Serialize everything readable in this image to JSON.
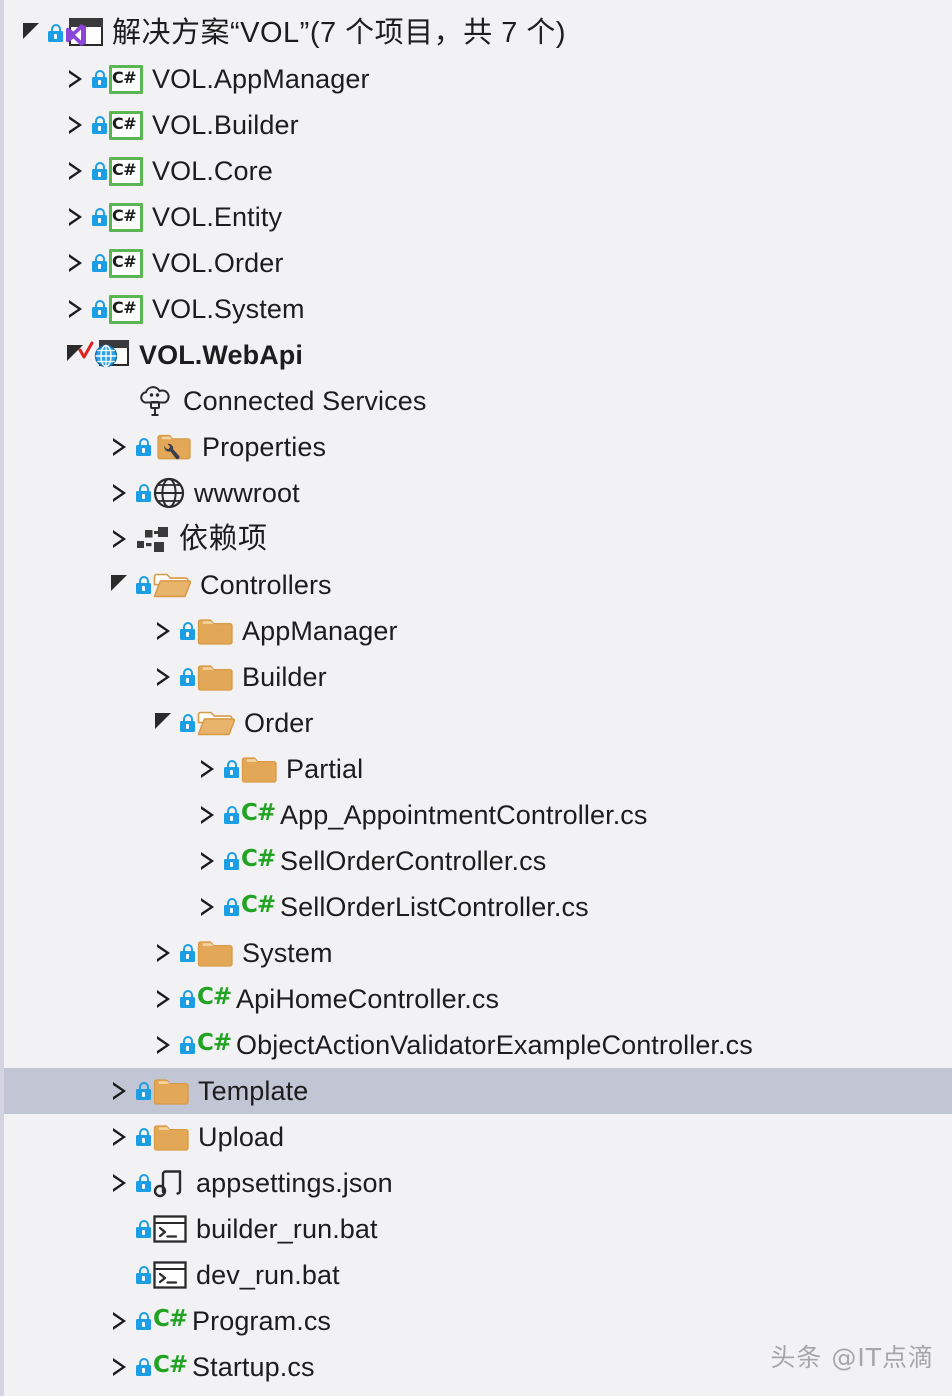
{
  "panel": {
    "name": "solution-explorer-tree",
    "background_color": "#f2f1f4",
    "selection_color": "#c2c5d4",
    "left_border_color": "#d4d4e0",
    "accent_green": "#5ab552",
    "accent_cs_green": "#22a324",
    "lock_blue": "#1b9ee3",
    "folder_orange": "#e3a857",
    "check_red": "#e02020"
  },
  "watermark": {
    "text": "头条 @IT点滴"
  },
  "tree": [
    {
      "label": "解决方案“VOL”(7 个项目，共 7 个)",
      "depth": 0,
      "icon": "solution-icon",
      "expander": "expanded",
      "lock": true,
      "bold": false,
      "cjk": true,
      "selected": false,
      "check": false
    },
    {
      "label": "VOL.AppManager",
      "depth": 1,
      "icon": "csharp-project-icon",
      "expander": "collapsed",
      "lock": true,
      "bold": false,
      "cjk": false,
      "selected": false,
      "check": false
    },
    {
      "label": "VOL.Builder",
      "depth": 1,
      "icon": "csharp-project-icon",
      "expander": "collapsed",
      "lock": true,
      "bold": false,
      "cjk": false,
      "selected": false,
      "check": false
    },
    {
      "label": "VOL.Core",
      "depth": 1,
      "icon": "csharp-project-icon",
      "expander": "collapsed",
      "lock": true,
      "bold": false,
      "cjk": false,
      "selected": false,
      "check": false
    },
    {
      "label": "VOL.Entity",
      "depth": 1,
      "icon": "csharp-project-icon",
      "expander": "collapsed",
      "lock": true,
      "bold": false,
      "cjk": false,
      "selected": false,
      "check": false
    },
    {
      "label": "VOL.Order",
      "depth": 1,
      "icon": "csharp-project-icon",
      "expander": "collapsed",
      "lock": true,
      "bold": false,
      "cjk": false,
      "selected": false,
      "check": false
    },
    {
      "label": "VOL.System",
      "depth": 1,
      "icon": "csharp-project-icon",
      "expander": "collapsed",
      "lock": true,
      "bold": false,
      "cjk": false,
      "selected": false,
      "check": false
    },
    {
      "label": "VOL.WebApi",
      "depth": 1,
      "icon": "webapi-project-icon",
      "expander": "expanded",
      "lock": false,
      "bold": true,
      "cjk": false,
      "selected": false,
      "check": true
    },
    {
      "label": "Connected Services",
      "depth": 2,
      "icon": "cloud-plug-icon",
      "expander": "none",
      "lock": false,
      "bold": false,
      "cjk": false,
      "selected": false,
      "check": false
    },
    {
      "label": "Properties",
      "depth": 2,
      "icon": "properties-folder-icon",
      "expander": "collapsed",
      "lock": true,
      "bold": false,
      "cjk": false,
      "selected": false,
      "check": false
    },
    {
      "label": "wwwroot",
      "depth": 2,
      "icon": "globe-icon",
      "expander": "collapsed",
      "lock": true,
      "bold": false,
      "cjk": false,
      "selected": false,
      "check": false
    },
    {
      "label": "依赖项",
      "depth": 2,
      "icon": "dependencies-icon",
      "expander": "collapsed",
      "lock": false,
      "bold": false,
      "cjk": true,
      "selected": false,
      "check": false
    },
    {
      "label": "Controllers",
      "depth": 2,
      "icon": "folder-open-icon",
      "expander": "expanded",
      "lock": true,
      "bold": false,
      "cjk": false,
      "selected": false,
      "check": false
    },
    {
      "label": "AppManager",
      "depth": 3,
      "icon": "folder-closed-icon",
      "expander": "collapsed",
      "lock": true,
      "bold": false,
      "cjk": false,
      "selected": false,
      "check": false
    },
    {
      "label": "Builder",
      "depth": 3,
      "icon": "folder-closed-icon",
      "expander": "collapsed",
      "lock": true,
      "bold": false,
      "cjk": false,
      "selected": false,
      "check": false
    },
    {
      "label": "Order",
      "depth": 3,
      "icon": "folder-open-icon",
      "expander": "expanded",
      "lock": true,
      "bold": false,
      "cjk": false,
      "selected": false,
      "check": false
    },
    {
      "label": "Partial",
      "depth": 4,
      "icon": "folder-closed-icon",
      "expander": "collapsed",
      "lock": true,
      "bold": false,
      "cjk": false,
      "selected": false,
      "check": false
    },
    {
      "label": "App_AppointmentController.cs",
      "depth": 4,
      "icon": "csharp-file-icon",
      "expander": "collapsed",
      "lock": true,
      "bold": false,
      "cjk": false,
      "selected": false,
      "check": false
    },
    {
      "label": "SellOrderController.cs",
      "depth": 4,
      "icon": "csharp-file-icon",
      "expander": "collapsed",
      "lock": true,
      "bold": false,
      "cjk": false,
      "selected": false,
      "check": false
    },
    {
      "label": "SellOrderListController.cs",
      "depth": 4,
      "icon": "csharp-file-icon",
      "expander": "collapsed",
      "lock": true,
      "bold": false,
      "cjk": false,
      "selected": false,
      "check": false
    },
    {
      "label": "System",
      "depth": 3,
      "icon": "folder-closed-icon",
      "expander": "collapsed",
      "lock": true,
      "bold": false,
      "cjk": false,
      "selected": false,
      "check": false
    },
    {
      "label": "ApiHomeController.cs",
      "depth": 3,
      "icon": "csharp-file-icon",
      "expander": "collapsed",
      "lock": true,
      "bold": false,
      "cjk": false,
      "selected": false,
      "check": false
    },
    {
      "label": "ObjectActionValidatorExampleController.cs",
      "depth": 3,
      "icon": "csharp-file-icon",
      "expander": "collapsed",
      "lock": true,
      "bold": false,
      "cjk": false,
      "selected": false,
      "check": false
    },
    {
      "label": "Template",
      "depth": 2,
      "icon": "folder-closed-icon",
      "expander": "collapsed",
      "lock": true,
      "bold": false,
      "cjk": false,
      "selected": true,
      "check": false
    },
    {
      "label": "Upload",
      "depth": 2,
      "icon": "folder-closed-icon",
      "expander": "collapsed",
      "lock": true,
      "bold": false,
      "cjk": false,
      "selected": false,
      "check": false
    },
    {
      "label": "appsettings.json",
      "depth": 2,
      "icon": "json-file-icon",
      "expander": "collapsed",
      "lock": true,
      "bold": false,
      "cjk": false,
      "selected": false,
      "check": false
    },
    {
      "label": "builder_run.bat",
      "depth": 2,
      "icon": "batch-file-icon",
      "expander": "none",
      "lock": true,
      "bold": false,
      "cjk": false,
      "selected": false,
      "check": false
    },
    {
      "label": "dev_run.bat",
      "depth": 2,
      "icon": "batch-file-icon",
      "expander": "none",
      "lock": true,
      "bold": false,
      "cjk": false,
      "selected": false,
      "check": false
    },
    {
      "label": "Program.cs",
      "depth": 2,
      "icon": "csharp-file-icon",
      "expander": "collapsed",
      "lock": true,
      "bold": false,
      "cjk": false,
      "selected": false,
      "check": false
    },
    {
      "label": "Startup.cs",
      "depth": 2,
      "icon": "csharp-file-icon",
      "expander": "collapsed",
      "lock": true,
      "bold": false,
      "cjk": false,
      "selected": false,
      "check": false
    }
  ]
}
